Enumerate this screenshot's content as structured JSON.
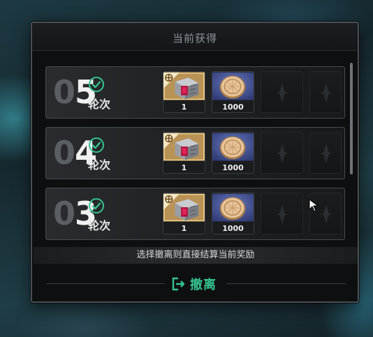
{
  "panel": {
    "title": "当前获得",
    "notice": "选择撤离则直接结算当前奖励",
    "withdraw_label": "撤离"
  },
  "rounds": [
    {
      "num_prefix": "0",
      "num_digit": "5",
      "label": "轮次",
      "items": [
        {
          "icon": "treasure-chest-icon",
          "count": "1"
        },
        {
          "icon": "gold-coin-icon",
          "count": "1000"
        }
      ]
    },
    {
      "num_prefix": "0",
      "num_digit": "4",
      "label": "轮次",
      "items": [
        {
          "icon": "treasure-chest-icon",
          "count": "1"
        },
        {
          "icon": "gold-coin-icon",
          "count": "1000"
        }
      ]
    },
    {
      "num_prefix": "0",
      "num_digit": "3",
      "label": "轮次",
      "items": [
        {
          "icon": "treasure-chest-icon",
          "count": "1"
        },
        {
          "icon": "gold-coin-icon",
          "count": "1000"
        }
      ]
    }
  ],
  "colors": {
    "accent_green": "#35c490",
    "panel_bg": "#0d0f11",
    "chest_frame": "#d9b46a",
    "coin_bg": "#3a4a8a"
  }
}
